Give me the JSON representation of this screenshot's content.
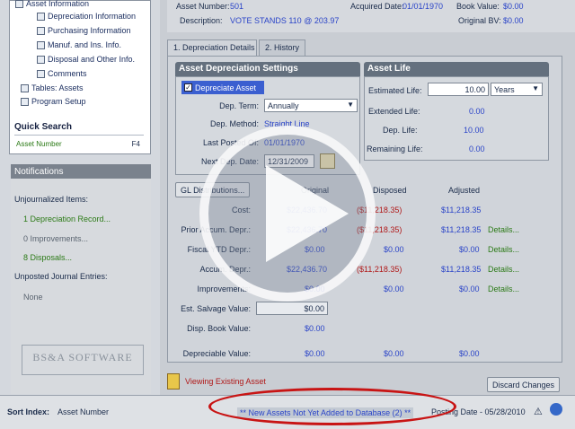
{
  "sidebar": {
    "tree": [
      {
        "label": "Asset Information"
      },
      {
        "label": "Depreciation Information"
      },
      {
        "label": "Purchasing Information"
      },
      {
        "label": "Manuf. and Ins. Info."
      },
      {
        "label": "Disposal and Other Info."
      },
      {
        "label": "Comments"
      },
      {
        "label": "Tables: Assets"
      },
      {
        "label": "Program Setup"
      }
    ],
    "quick_search": {
      "title": "Quick Search",
      "field": "Asset Number",
      "key": "F4"
    },
    "notifications": {
      "title": "Notifications",
      "unjournalized": "Unjournalized Items:",
      "depr_records": "1 Depreciation Record...",
      "improvements": "0 Improvements...",
      "disposals": "8 Disposals...",
      "unposted": "Unposted Journal Entries:",
      "none": "None"
    },
    "logo_text": "BS&A SOFTWARE"
  },
  "header": {
    "asset_number_label": "Asset Number:",
    "asset_number": "501",
    "description_label": "Description:",
    "description": "VOTE STANDS 110 @ 203.97",
    "acquired_label": "Acquired Date:",
    "acquired": "01/01/1970",
    "book_value_label": "Book Value:",
    "book_value": "$0.00",
    "original_bv_label": "Original BV:",
    "original_bv": "$0.00"
  },
  "tabs": [
    {
      "label": "1. Depreciation Details"
    },
    {
      "label": "2. History"
    }
  ],
  "settings": {
    "title": "Asset Depreciation Settings",
    "depreciate_label": "Depreciate Asset",
    "dep_term_label": "Dep. Term:",
    "dep_term": "Annually",
    "dep_method_label": "Dep. Method:",
    "dep_method": "Straight Line",
    "last_posted_label": "Last Posted Of:",
    "last_posted": "01/01/1970",
    "next_dep_label": "Next Dep. Date:",
    "next_dep": "12/31/2009"
  },
  "asset_life": {
    "title": "Asset Life",
    "estimated_label": "Estimated Life:",
    "estimated": "10.00",
    "unit": "Years",
    "extended_label": "Extended Life:",
    "extended": "0.00",
    "dep_life_label": "Dep. Life:",
    "dep_life": "10.00",
    "remaining_label": "Remaining Life:",
    "remaining": "0.00"
  },
  "grid": {
    "gl_button": "GL Distributions...",
    "col_original": "Original",
    "col_disposed": "Disposed",
    "col_adjusted": "Adjusted",
    "rows": [
      {
        "label": "Cost:",
        "original": "$22,436.70",
        "disposed": "($11,218.35)",
        "adjusted": "$11,218.35",
        "details": ""
      },
      {
        "label": "Prior Accum. Depr.:",
        "original": "$22,436.70",
        "disposed": "($11,218.35)",
        "adjusted": "$11,218.35",
        "details": "Details..."
      },
      {
        "label": "Fiscal YTD Depr.:",
        "original": "$0.00",
        "disposed": "$0.00",
        "adjusted": "$0.00",
        "details": "Details..."
      },
      {
        "label": "Accum. Depr.:",
        "original": "$22,436.70",
        "disposed": "($11,218.35)",
        "adjusted": "$11,218.35",
        "details": "Details..."
      },
      {
        "label": "Improvements:",
        "original": "$0.00",
        "disposed": "$0.00",
        "adjusted": "$0.00",
        "details": "Details..."
      }
    ],
    "est_salvage_label": "Est. Salvage Value:",
    "est_salvage": "$0.00",
    "disp_book_label": "Disp. Book Value:",
    "disp_book": "$0.00",
    "depreciable_label": "Depreciable Value:",
    "depreciable_original": "$0.00",
    "depreciable_disposed": "$0.00",
    "depreciable_adjusted": "$0.00"
  },
  "footer": {
    "viewing": "Viewing Existing Asset",
    "discard": "Discard Changes"
  },
  "status_bar": {
    "sort_label": "Sort Index:",
    "sort_value": "Asset Number",
    "new_assets": "** New Assets Not Yet Added to Database (2) **",
    "posting_date": "Posting Date - 05/28/2010"
  },
  "colors": {
    "accent_blue": "#2a44c8",
    "disposed_red": "#b01818",
    "notif_green": "#2b7a16",
    "oval_red": "#c81414"
  }
}
